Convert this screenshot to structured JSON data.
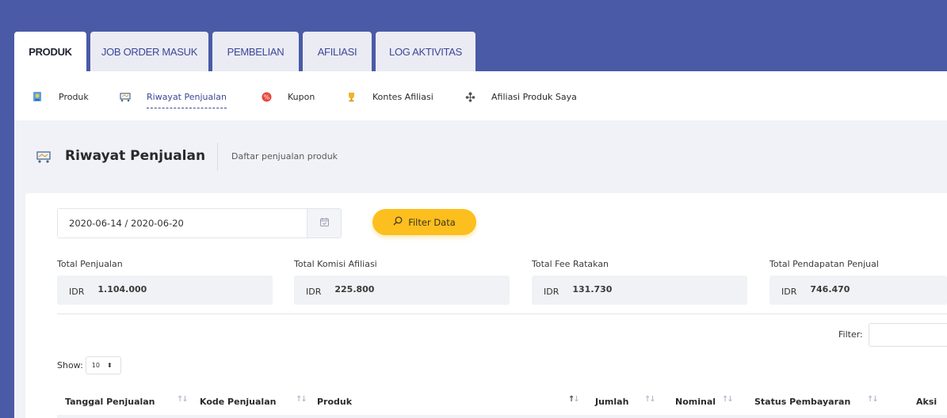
{
  "tabs": [
    {
      "label": "PRODUK",
      "active": true
    },
    {
      "label": "JOB ORDER MASUK",
      "active": false
    },
    {
      "label": "PEMBELIAN",
      "active": false
    },
    {
      "label": "AFILIASI",
      "active": false
    },
    {
      "label": "LOG AKTIVITAS",
      "active": false
    }
  ],
  "subnav": [
    {
      "label": "Produk",
      "icon": "product-icon"
    },
    {
      "label": "Riwayat Penjualan",
      "icon": "cart-icon",
      "active": true
    },
    {
      "label": "Kupon",
      "icon": "coupon-icon"
    },
    {
      "label": "Kontes Afiliasi",
      "icon": "trophy-icon"
    },
    {
      "label": "Afiliasi Produk Saya",
      "icon": "network-icon"
    }
  ],
  "header": {
    "title": "Riwayat Penjualan",
    "subtitle": "Daftar penjualan produk"
  },
  "filters": {
    "date_range": "2020-06-14 / 2020-06-20",
    "filter_button": "Filter Data"
  },
  "stats": [
    {
      "label": "Total Penjualan",
      "currency": "IDR",
      "value": "1.104.000"
    },
    {
      "label": "Total Komisi Afiliasi",
      "currency": "IDR",
      "value": "225.800"
    },
    {
      "label": "Total Fee Ratakan",
      "currency": "IDR",
      "value": "131.730"
    },
    {
      "label": "Total Pendapatan Penjual",
      "currency": "IDR",
      "value": "746.470"
    }
  ],
  "table": {
    "filter_label": "Filter:",
    "show_label": "Show:",
    "show_value": "10",
    "columns": [
      "Tanggal Penjualan",
      "Kode Penjualan",
      "Produk",
      "Jumlah",
      "Nominal",
      "Status Pembayaran",
      "Aksi"
    ]
  },
  "colors": {
    "brand": "#4a5aa6",
    "accent": "#fdbf1e",
    "active_link": "#3b4896"
  }
}
